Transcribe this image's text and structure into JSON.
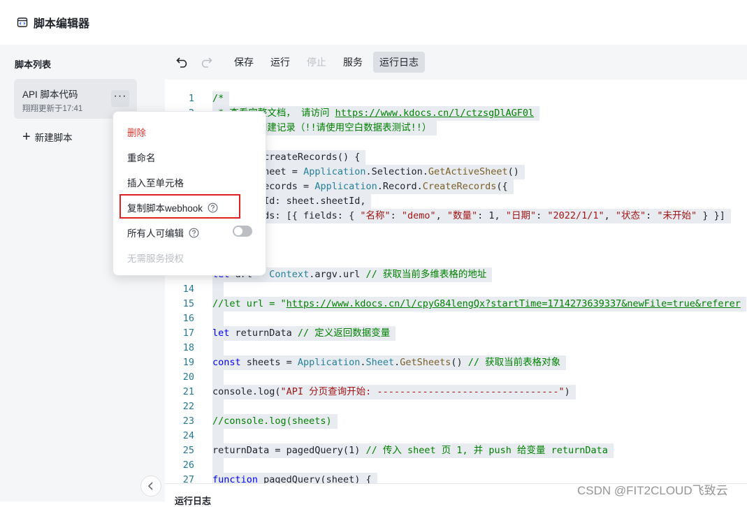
{
  "header": {
    "title": "脚本编辑器"
  },
  "sidebar": {
    "list_title": "脚本列表",
    "script": {
      "name": "API 脚本代码",
      "updated": "翔翔更新于17:41",
      "more": "···"
    },
    "new_script": "新建脚本"
  },
  "toolbar": {
    "save": "保存",
    "run": "运行",
    "stop": "停止",
    "service": "服务",
    "run_log": "运行日志"
  },
  "menu": {
    "delete": "删除",
    "rename": "重命名",
    "insert_cell": "插入至单元格",
    "copy_webhook": "复制脚本webhook",
    "everyone_edit": "所有人可编辑",
    "everyone_edit_enabled": false,
    "no_auth": "无需服务授权"
  },
  "editor": {
    "line_numbers": [
      "1",
      "2",
      "",
      "",
      "",
      "",
      "",
      "",
      "",
      "",
      "",
      "",
      "",
      "14",
      "15",
      "16",
      "17",
      "18",
      "19",
      "20",
      "21",
      "22",
      "23",
      "24",
      "25",
      "26",
      "27"
    ],
    "lines": [
      "/*",
      " * 查看完整文档， 请访问 https://www.kdocs.cn/l/ctzsgDlAGF0l",
      " * 示例：创建记录（!!请使用空白数据表测试!!）",
      "",
      "function createRecords() {",
      "  const sheet = Application.Selection.GetActiveSheet()",
      "  const records = Application.Record.CreateRecords({",
      "    SheetId: sheet.sheetId,",
      "    Records: [{ fields: { \"名称\": \"demo\", \"数量\": 1, \"日期\": \"2022/1/1\", \"状态\": \"未开始\" } }]",
      "",
      "",
      "",
      "let url = Context.argv.url // 获取当前多维表格的地址",
      "",
      "//let url = \"https://www.kdocs.cn/l/cpyG84lengQx?startTime=1714273639337&newFile=true&referer",
      "",
      "let returnData // 定义返回数据变量",
      "",
      "const sheets = Application.Sheet.GetSheets() // 获取当前表格对象",
      "",
      "console.log(\"API 分页查询开始: --------------------------------\")",
      "",
      "//console.log(sheets)",
      "",
      "returnData = pagedQuery(1) // 传入 sheet 页 1, 并 push 给变量 returnData",
      "",
      "function pagedQuery(sheet) {"
    ]
  },
  "log_panel": {
    "title": "运行日志"
  },
  "watermark": "CSDN @FIT2CLOUD飞致云"
}
